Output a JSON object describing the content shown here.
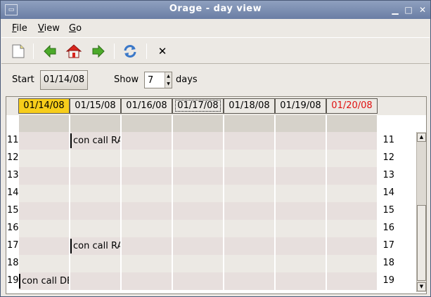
{
  "window": {
    "title": "Orage - day view"
  },
  "menu": [
    {
      "label": "File",
      "mnemonic": "F",
      "rest": "ile"
    },
    {
      "label": "View",
      "mnemonic": "V",
      "rest": "iew"
    },
    {
      "label": "Go",
      "mnemonic": "G",
      "rest": "o"
    }
  ],
  "toolbar": {
    "buttons": [
      "new-icon",
      "back-arrow-icon",
      "home-icon",
      "forward-arrow-icon",
      "refresh-icon",
      "close-icon"
    ],
    "close_glyph": "✕"
  },
  "controls": {
    "start_label": "Start",
    "start_value": "01/14/08",
    "show_label": "Show",
    "show_value": "7",
    "days_label": "days"
  },
  "days": [
    {
      "label": "01/14/08",
      "state": "today"
    },
    {
      "label": "01/15/08",
      "state": ""
    },
    {
      "label": "01/16/08",
      "state": ""
    },
    {
      "label": "01/17/08",
      "state": "focus"
    },
    {
      "label": "01/18/08",
      "state": ""
    },
    {
      "label": "01/19/08",
      "state": ""
    },
    {
      "label": "01/20/08",
      "state": "sunday"
    }
  ],
  "hours": [
    "11",
    "12",
    "13",
    "14",
    "15",
    "16",
    "17",
    "18",
    "19"
  ],
  "events": [
    {
      "day": 1,
      "hour": "11",
      "label": "con call RA"
    },
    {
      "day": 1,
      "hour": "17",
      "label": "con call RA"
    },
    {
      "day": 0,
      "hour": "19",
      "label": "con call DB"
    }
  ],
  "colors": {
    "today": "#f7cd1a",
    "sunday": "#e01010",
    "row_odd": "#e7dfdd",
    "row_even": "#ece9e4"
  }
}
